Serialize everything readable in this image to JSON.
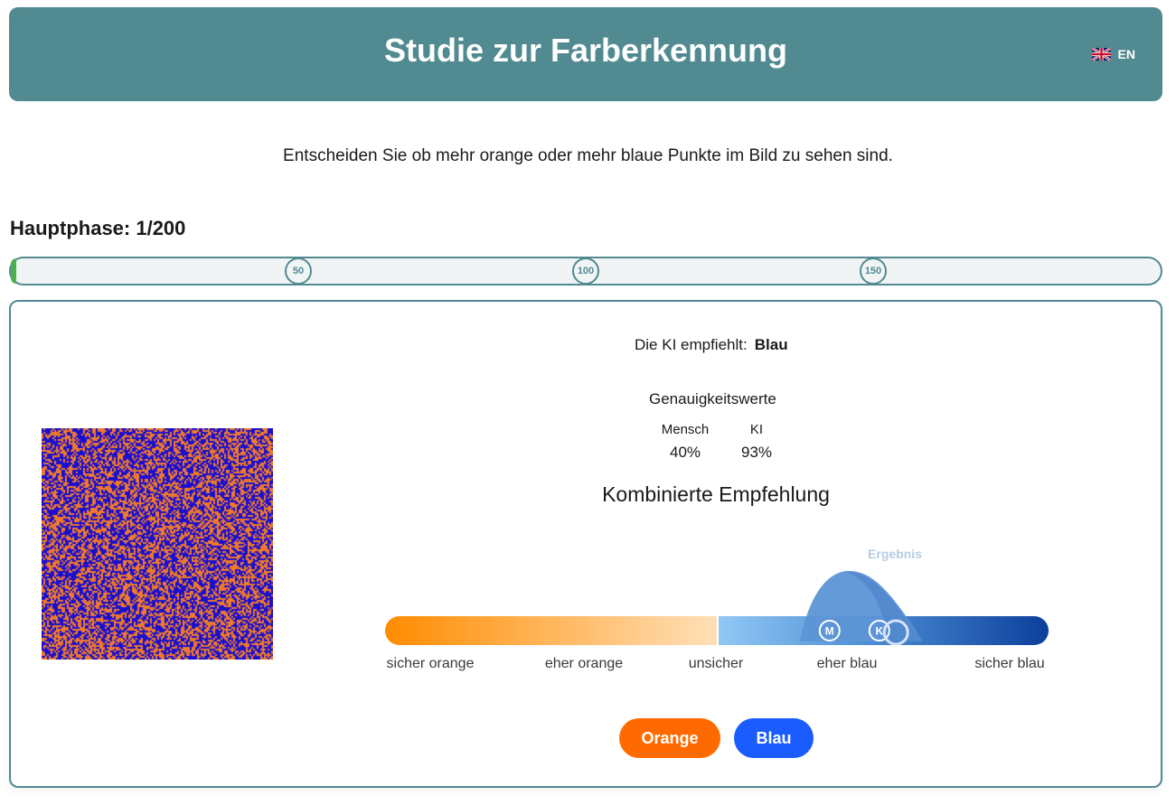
{
  "header": {
    "title": "Studie zur Farberkennung",
    "language_label": "EN",
    "background_color": "#518a91"
  },
  "instruction": "Entscheiden Sie ob mehr orange oder mehr blaue Punkte im Bild zu sehen sind.",
  "phase": {
    "label": "Hauptphase: 1/200",
    "current": 1,
    "total": 200,
    "milestones": [
      "50",
      "100",
      "150"
    ],
    "milestone_values": [
      50,
      100,
      150
    ]
  },
  "stimulus": {
    "colors": [
      "#1a0fd0",
      "#f07a2a"
    ]
  },
  "recommendation": {
    "label": "Die KI empfiehlt:",
    "value": "Blau"
  },
  "accuracy": {
    "title": "Genauigkeitswerte",
    "human_label": "Mensch",
    "human_value": "40%",
    "ai_label": "KI",
    "ai_value": "93%"
  },
  "combined": {
    "title": "Kombinierte Empfehlung",
    "result_label": "Ergebnis",
    "human_marker": "M",
    "ai_marker": "K",
    "human_position": 0.67,
    "ai_position": 0.745,
    "result_position": 0.77,
    "scale_labels": [
      "sicher orange",
      "eher orange",
      "unsicher",
      "eher blau",
      "sicher blau"
    ]
  },
  "buttons": {
    "orange": "Orange",
    "blue": "Blau"
  }
}
